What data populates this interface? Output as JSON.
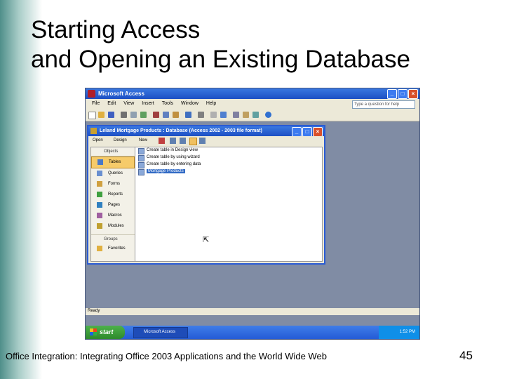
{
  "slide": {
    "title_line1": "Starting Access",
    "title_line2": "and Opening an Existing Database",
    "footer": "Office Integration: Integrating Office 2003 Applications  and the World Wide Web",
    "page_number": "45"
  },
  "app": {
    "title": "Microsoft Access",
    "menu": [
      "File",
      "Edit",
      "View",
      "Insert",
      "Tools",
      "Window",
      "Help"
    ],
    "help_box_placeholder": "Type a question for help"
  },
  "db_window": {
    "title": "Leland Mortgage Products : Database (Access 2002 - 2003 file format)",
    "toolbar": {
      "open": "Open",
      "design": "Design",
      "new": "New"
    },
    "objects_header": "Objects",
    "objects": [
      "Tables",
      "Queries",
      "Forms",
      "Reports",
      "Pages",
      "Macros",
      "Modules"
    ],
    "selected_object": "Tables",
    "groups_header": "Groups",
    "groups": [
      "Favorites"
    ],
    "items": [
      "Create table in Design view",
      "Create table by using wizard",
      "Create table by entering data",
      "Mortgage Products"
    ],
    "selected_item": "Mortgage Products"
  },
  "status_text": "Ready",
  "taskbar": {
    "start_label": "start",
    "task_label": "Microsoft Access",
    "clock": "1:52 PM"
  },
  "colors": {
    "title_bar": "#1c4fc4",
    "selection": "#316ac5",
    "start_button": "#2e8a2c"
  }
}
